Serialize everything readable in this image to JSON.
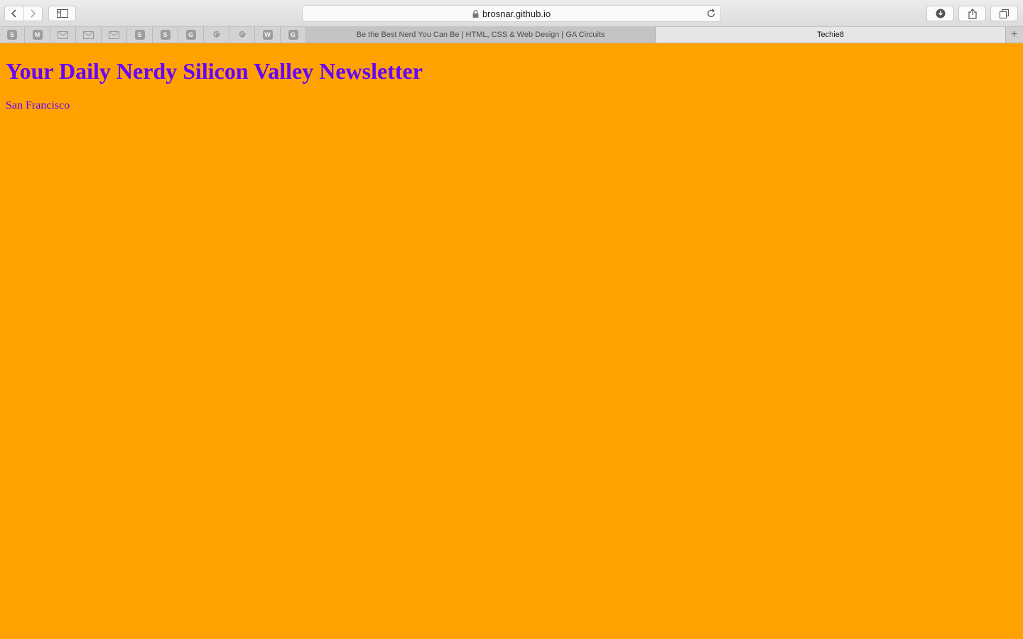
{
  "browser": {
    "address": "brosnar.github.io",
    "pinned_tabs": [
      {
        "glyph": "S",
        "icon": "s-favicon-icon"
      },
      {
        "glyph": "M",
        "icon": "m-favicon-icon"
      },
      {
        "glyph": "",
        "icon": "mail-icon"
      },
      {
        "glyph": "",
        "icon": "mail-icon"
      },
      {
        "glyph": "",
        "icon": "mail-icon"
      },
      {
        "glyph": "S",
        "icon": "s-favicon-icon"
      },
      {
        "glyph": "S",
        "icon": "s-favicon-icon"
      },
      {
        "glyph": "G",
        "icon": "g-favicon-icon"
      },
      {
        "glyph": "",
        "icon": "google-icon"
      },
      {
        "glyph": "",
        "icon": "google-icon"
      },
      {
        "glyph": "W",
        "icon": "w-favicon-icon"
      },
      {
        "glyph": "G",
        "icon": "g-favicon-icon"
      }
    ],
    "tabs": [
      {
        "label": "Be the Best Nerd You Can Be | HTML, CSS & Web Design | GA Circuits",
        "active": false
      },
      {
        "label": "Techie8",
        "active": true
      }
    ]
  },
  "page": {
    "heading": "Your Daily Nerdy Silicon Valley Newsletter",
    "location": "San Francisco",
    "background_color": "#ffa200",
    "text_color": "#6600ff"
  }
}
